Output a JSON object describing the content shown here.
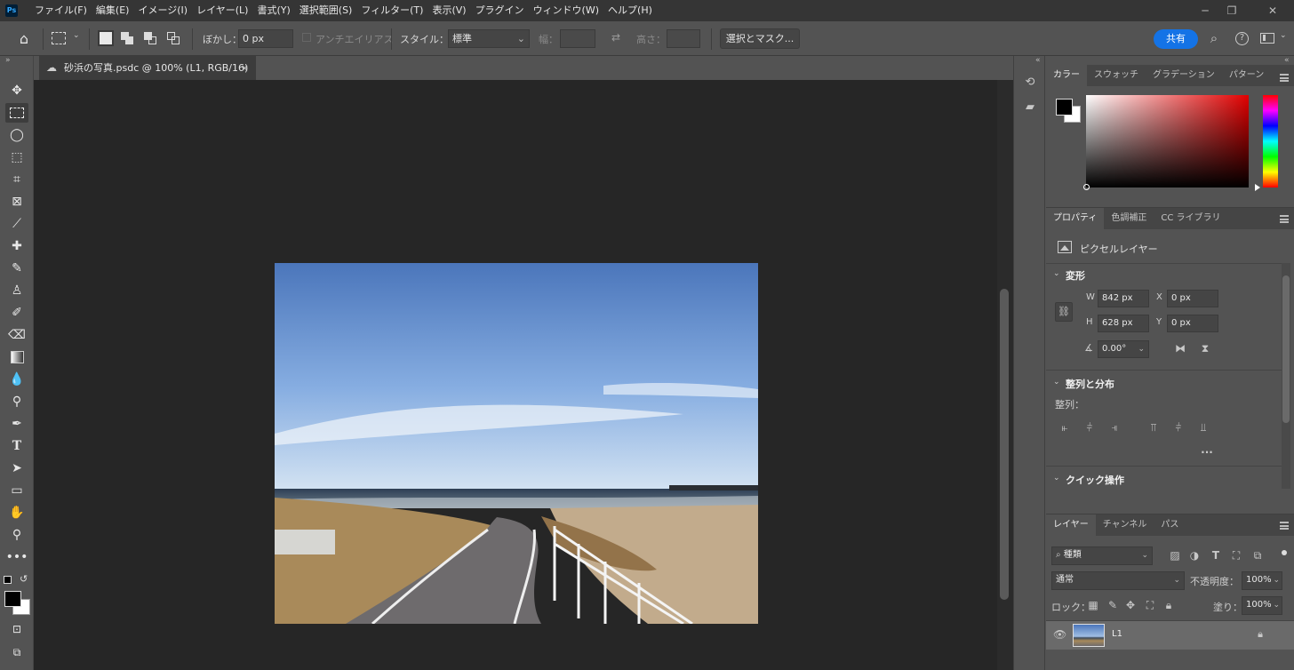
{
  "app": {
    "logo": "Ps"
  },
  "menu": [
    "ファイル(F)",
    "編集(E)",
    "イメージ(I)",
    "レイヤー(L)",
    "書式(Y)",
    "選択範囲(S)",
    "フィルター(T)",
    "表示(V)",
    "プラグイン",
    "ウィンドウ(W)",
    "ヘルプ(H)"
  ],
  "options": {
    "feather_label": "ぼかし：",
    "feather_value": "0 px",
    "antialias_label": "アンチエイリアス",
    "style_label": "スタイル：",
    "style_value": "標準",
    "width_label": "幅：",
    "height_label": "高さ：",
    "select_mask_label": "選択とマスク...",
    "share_label": "共有"
  },
  "document": {
    "tab_title": "砂浜の写真.psdc @ 100% (L1, RGB/16)",
    "close_glyph": "×"
  },
  "color_panel": {
    "tabs": [
      "カラー",
      "スウォッチ",
      "グラデーション",
      "パターン"
    ],
    "active_tab": 0,
    "foreground": "#000000",
    "background": "#ffffff"
  },
  "properties_panel": {
    "tabs": [
      "プロパティ",
      "色調補正",
      "CC ライブラリ"
    ],
    "active_tab": 0,
    "layer_type": "ピクセルレイヤー",
    "transform": {
      "heading": "変形",
      "w_label": "W",
      "w_value": "842 px",
      "x_label": "X",
      "x_value": "0 px",
      "h_label": "H",
      "h_value": "628 px",
      "y_label": "Y",
      "y_value": "0 px",
      "angle_value": "0.00°"
    },
    "align": {
      "heading": "整列と分布",
      "sub_label": "整列："
    },
    "quick": {
      "heading": "クイック操作"
    }
  },
  "layers_panel": {
    "tabs": [
      "レイヤー",
      "チャンネル",
      "パス"
    ],
    "active_tab": 0,
    "filter_label": "種類",
    "blend_mode": "通常",
    "opacity_label": "不透明度：",
    "opacity_value": "100%",
    "lock_label": "ロック：",
    "fill_label": "塗り：",
    "fill_value": "100%",
    "layers": [
      {
        "name": "L1",
        "visible": true,
        "locked": true
      }
    ]
  }
}
